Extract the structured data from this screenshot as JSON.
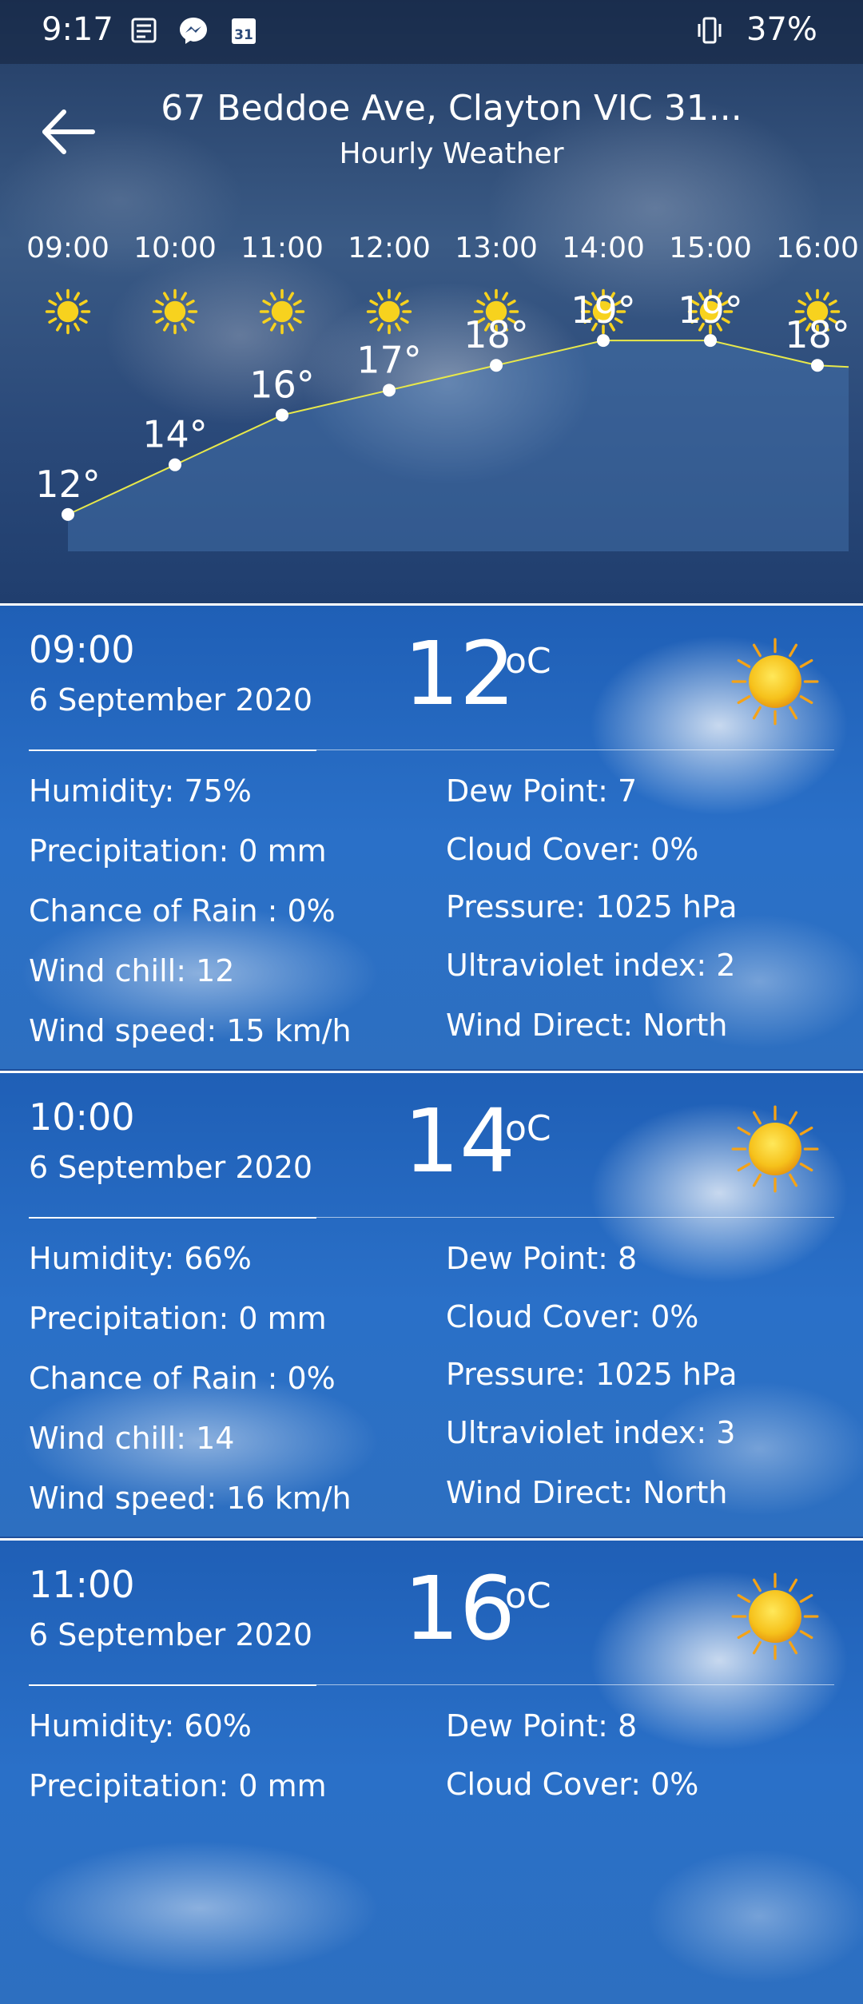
{
  "status_bar": {
    "time": "9:17",
    "battery": "37%",
    "icons": [
      "news-icon",
      "messenger-icon",
      "calendar-31-icon",
      "vibrate-icon"
    ]
  },
  "app_bar": {
    "title": "67 Beddoe Ave, Clayton VIC 31...",
    "subtitle": "Hourly Weather",
    "back_icon": "arrow-back-icon"
  },
  "hourly": {
    "hours": [
      "09:00",
      "10:00",
      "11:00",
      "12:00",
      "13:00",
      "14:00",
      "15:00",
      "16:00"
    ],
    "condition_icon": "sun-icon"
  },
  "chart_data": {
    "type": "line",
    "x": [
      "09:00",
      "10:00",
      "11:00",
      "12:00",
      "13:00",
      "14:00",
      "15:00",
      "16:00"
    ],
    "series": [
      {
        "values": [
          12,
          14,
          16,
          17,
          18,
          19,
          19,
          18
        ]
      }
    ],
    "data_labels": [
      "12°",
      "14°",
      "16°",
      "17°",
      "18°",
      "19°",
      "19°",
      "18°"
    ],
    "line_color": "#e8e84a"
  },
  "cards": [
    {
      "time": "09:00",
      "date": "6 September 2020",
      "temp": "12",
      "unit": "oC",
      "left": [
        "Humidity: 75%",
        "Precipitation: 0 mm",
        "Chance of Rain : 0%",
        "Wind chill: 12",
        "Wind speed: 15 km/h"
      ],
      "right": [
        "Dew Point: 7",
        "Cloud Cover: 0%",
        "Pressure: 1025 hPa",
        "Ultraviolet index: 2",
        "Wind Direct: North"
      ]
    },
    {
      "time": "10:00",
      "date": "6 September 2020",
      "temp": "14",
      "unit": "oC",
      "left": [
        "Humidity: 66%",
        "Precipitation: 0 mm",
        "Chance of Rain : 0%",
        "Wind chill: 14",
        "Wind speed: 16 km/h"
      ],
      "right": [
        "Dew Point: 8",
        "Cloud Cover: 0%",
        "Pressure: 1025 hPa",
        "Ultraviolet index: 3",
        "Wind Direct: North"
      ]
    },
    {
      "time": "11:00",
      "date": "6 September 2020",
      "temp": "16",
      "unit": "oC",
      "left": [
        "Humidity: 60%",
        "Precipitation: 0 mm"
      ],
      "right": [
        "Dew Point: 8",
        "Cloud Cover: 0%"
      ]
    }
  ],
  "colors": {
    "sun": "#f7d21e",
    "accent_line": "#e8e84a",
    "sky": "#2a70c8"
  }
}
